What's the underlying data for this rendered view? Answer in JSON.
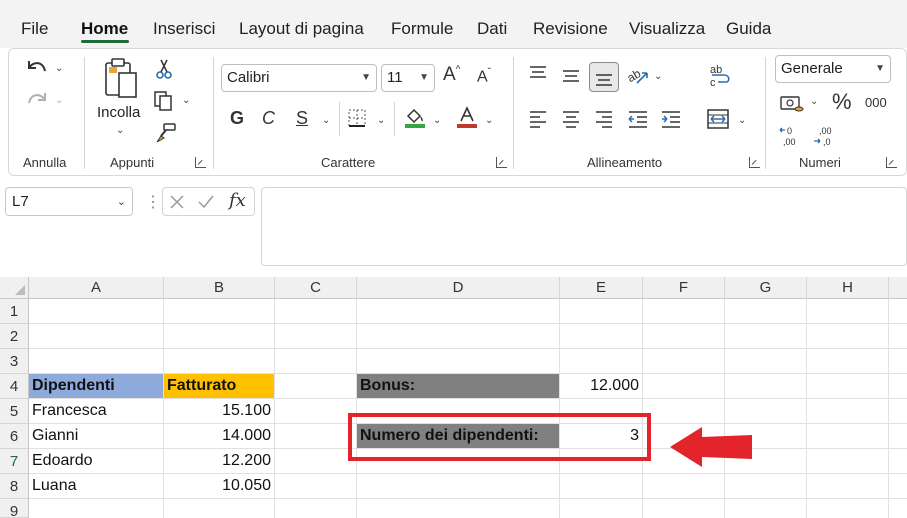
{
  "menu": {
    "tabs": [
      "File",
      "Home",
      "Inserisci",
      "Layout di pagina",
      "Formule",
      "Dati",
      "Revisione",
      "Visualizza",
      "Guida"
    ],
    "active_tab": "Home"
  },
  "ribbon": {
    "groups": {
      "annulla": "Annulla",
      "appunti": "Appunti",
      "carattere": "Carattere",
      "allineamento": "Allineamento",
      "numeri": "Numeri"
    },
    "paste_label": "Incolla",
    "font_name": "Calibri",
    "font_size": "11",
    "bold_label": "G",
    "italic_label": "C",
    "underline_label": "S",
    "number_format": "Generale",
    "percent_symbol": "%",
    "thousands_label": "000",
    "icons": [
      "undo-icon",
      "redo-icon",
      "paste-icon",
      "cut-icon",
      "copy-icon",
      "format-painter-icon",
      "grow-font-icon",
      "shrink-font-icon",
      "borders-icon",
      "fill-color-icon",
      "font-color-icon",
      "align-top-icon",
      "align-middle-icon",
      "align-bottom-icon",
      "orientation-icon",
      "wrap-text-icon",
      "align-left-icon",
      "align-center-icon",
      "align-right-icon",
      "decrease-indent-icon",
      "increase-indent-icon",
      "merge-center-icon",
      "accounting-format-icon",
      "increase-decimal-icon",
      "decrease-decimal-icon"
    ]
  },
  "formula_bar": {
    "name_box": "L7",
    "fx_label": "fx",
    "formula": ""
  },
  "sheet": {
    "columns": [
      "A",
      "B",
      "C",
      "D",
      "E",
      "F",
      "G",
      "H"
    ],
    "rows": [
      "1",
      "2",
      "3",
      "4",
      "5",
      "6",
      "7",
      "8",
      "9"
    ],
    "selected_row": "7",
    "cells": {
      "A4": "Dipendenti",
      "B4": "Fatturato",
      "A5": "Francesca",
      "B5": "15.100",
      "A6": "Gianni",
      "B6": "14.000",
      "A7": "Edoardo",
      "B7": "12.200",
      "A8": "Luana",
      "B8": "10.050",
      "D4": "Bonus:",
      "E4": "12.000",
      "D6": "Numero dei dipendenti:",
      "E6": "3"
    }
  },
  "colors": {
    "header_blue": "#8eaadb",
    "header_orange": "#ffc000",
    "label_gray": "#808080",
    "highlight_red": "#e3242b",
    "accent_green": "#1f6a3a"
  }
}
